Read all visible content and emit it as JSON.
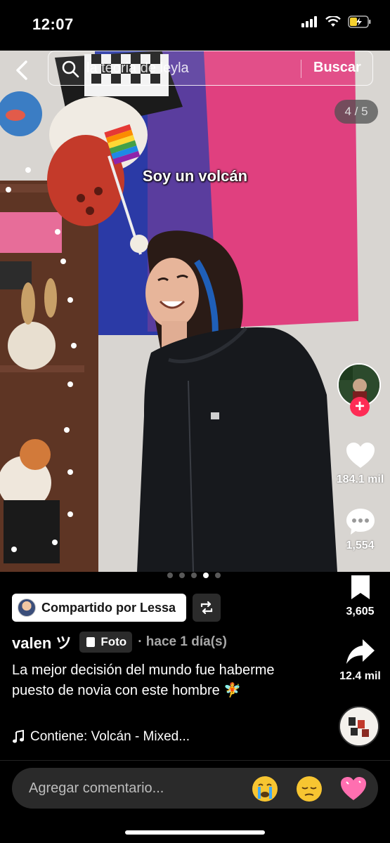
{
  "status_bar": {
    "time": "12:07"
  },
  "search": {
    "query": "la teoria de leyla",
    "button": "Buscar"
  },
  "photo": {
    "counter": "4 / 5",
    "overlay_caption": "Soy un volcán",
    "dots_total": 5,
    "dots_active_index": 3
  },
  "rail": {
    "likes": "184.1 mil",
    "comments": "1,554",
    "saves": "3,605",
    "shares": "12.4 mil"
  },
  "shared": {
    "label": "Compartido por Lessa"
  },
  "author": {
    "name": "valen ツ",
    "type_badge": "Foto",
    "time": "· hace 1 día(s)"
  },
  "description": "La mejor decisión del mundo fue haberme puesto de novia con este hombre 🧚",
  "sound": "Contiene: Volcán - Mixed...",
  "comment": {
    "placeholder": "Agregar comentario..."
  },
  "icons": [
    "back-icon",
    "search-icon",
    "heart-icon",
    "comment-icon",
    "bookmark-icon",
    "share-icon",
    "repost-icon",
    "music-note-icon",
    "photo-icon",
    "wifi-icon",
    "signal-icon",
    "battery-icon"
  ],
  "colors": {
    "accent": "#fe2c55",
    "flag_pink": "#e0407f",
    "flag_purple": "#5a3d9e",
    "flag_blue": "#2b3aa6"
  }
}
